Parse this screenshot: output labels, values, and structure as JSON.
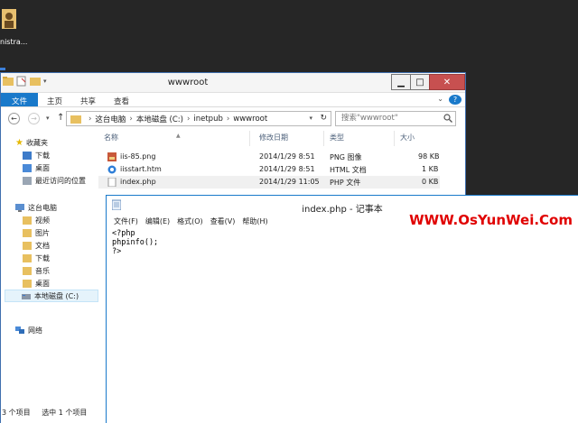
{
  "desktop": {
    "icon_label": "nistra..."
  },
  "explorer": {
    "title": "wwwroot",
    "ribbon_tabs": [
      "文件",
      "主页",
      "共享",
      "查看"
    ],
    "help_label": "?",
    "breadcrumb": [
      "这台电脑",
      "本地磁盘 (C:)",
      "inetpub",
      "wwwroot"
    ],
    "search_placeholder": "搜索\"wwwroot\"",
    "columns": [
      "名称",
      "修改日期",
      "类型",
      "大小"
    ],
    "files": [
      {
        "name": "iis-85.png",
        "date": "2014/1/29 8:51",
        "type": "PNG 图像",
        "size": "98 KB"
      },
      {
        "name": "iisstart.htm",
        "date": "2014/1/29 8:51",
        "type": "HTML 文档",
        "size": "1 KB"
      },
      {
        "name": "index.php",
        "date": "2014/1/29 11:05",
        "type": "PHP 文件",
        "size": "0 KB"
      }
    ],
    "nav": {
      "favorites": "收藏夹",
      "fav_items": [
        "下载",
        "桌面",
        "最近访问的位置"
      ],
      "this_pc": "这台电脑",
      "pc_items": [
        "视频",
        "图片",
        "文档",
        "下载",
        "音乐",
        "桌面"
      ],
      "drive": "本地磁盘 (C:)",
      "network": "网络"
    },
    "status_count": "3 个项目",
    "status_selected": "选中 1 个项目"
  },
  "notepad": {
    "title": "index.php - 记事本",
    "menu": [
      "文件(F)",
      "编辑(E)",
      "格式(O)",
      "查看(V)",
      "帮助(H)"
    ],
    "content": "<?php\nphpinfo();\n?>"
  },
  "watermark": "WWW.OsYunWei.Com",
  "colors": {
    "desktop": "#262626",
    "accent": "#1979ca",
    "watermark": "#e00000",
    "close_button": "#c75050"
  }
}
